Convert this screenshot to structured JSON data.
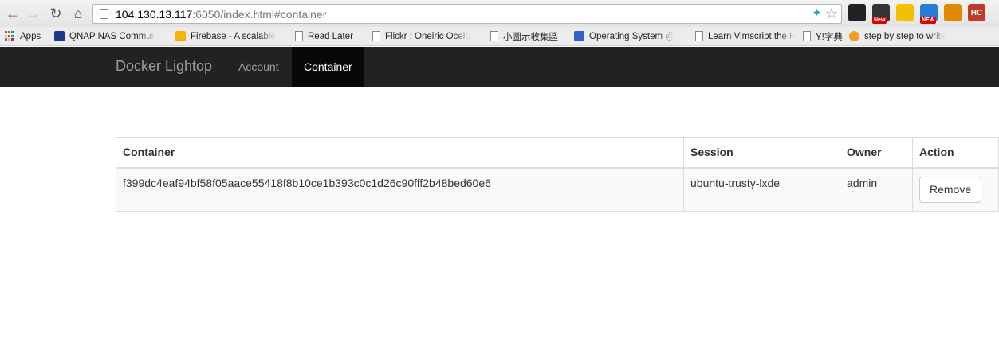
{
  "browser": {
    "url_host": "104.130.13.117",
    "url_path": ":6050/index.html#container",
    "extensions": [
      {
        "name": "ext-glasses",
        "label": "",
        "color": "#222"
      },
      {
        "name": "ext-new-1",
        "label": "",
        "color": "#333",
        "badge": "New"
      },
      {
        "name": "ext-phone",
        "label": "",
        "color": "#f2c200"
      },
      {
        "name": "ext-new-2",
        "label": "",
        "color": "#2b7bd6",
        "badge": "NEW"
      },
      {
        "name": "ext-tool",
        "label": "",
        "color": "#e08a00"
      },
      {
        "name": "ext-hc",
        "label": "HC",
        "color": "#c0392b"
      }
    ]
  },
  "bookmarks": [
    {
      "label": "Apps",
      "icon": "apps-grid-icon"
    },
    {
      "label": "QNAP NAS Commun",
      "icon": "qnap-icon",
      "color": "#1a3a8a"
    },
    {
      "label": "Firebase - A scalable",
      "icon": "firebase-icon",
      "color": "#f5b400"
    },
    {
      "label": "Read Later",
      "icon": "page-icon"
    },
    {
      "label": "Flickr : Oneiric Ocelo",
      "icon": "page-icon"
    },
    {
      "label": "小圖示收集區",
      "icon": "page-icon"
    },
    {
      "label": "Operating System @",
      "icon": "chat-icon",
      "color": "#2d63c8"
    },
    {
      "label": "Learn Vimscript the H",
      "icon": "page-icon"
    },
    {
      "label": "Y!字典",
      "icon": "page-icon"
    },
    {
      "label": "step by step to write",
      "icon": "user-icon",
      "color": "#f0a020"
    }
  ],
  "app": {
    "brand": "Docker Lightop",
    "nav": [
      {
        "label": "Account",
        "active": false
      },
      {
        "label": "Container",
        "active": true
      }
    ]
  },
  "table": {
    "headers": [
      "Container",
      "Session",
      "Owner",
      "Action"
    ],
    "rows": [
      {
        "container": "f399dc4eaf94bf58f05aace55418f8b10ce1b393c0c1d26c90fff2b48bed60e6",
        "session": "ubuntu-trusty-lxde",
        "owner": "admin",
        "action": "Remove"
      }
    ]
  }
}
